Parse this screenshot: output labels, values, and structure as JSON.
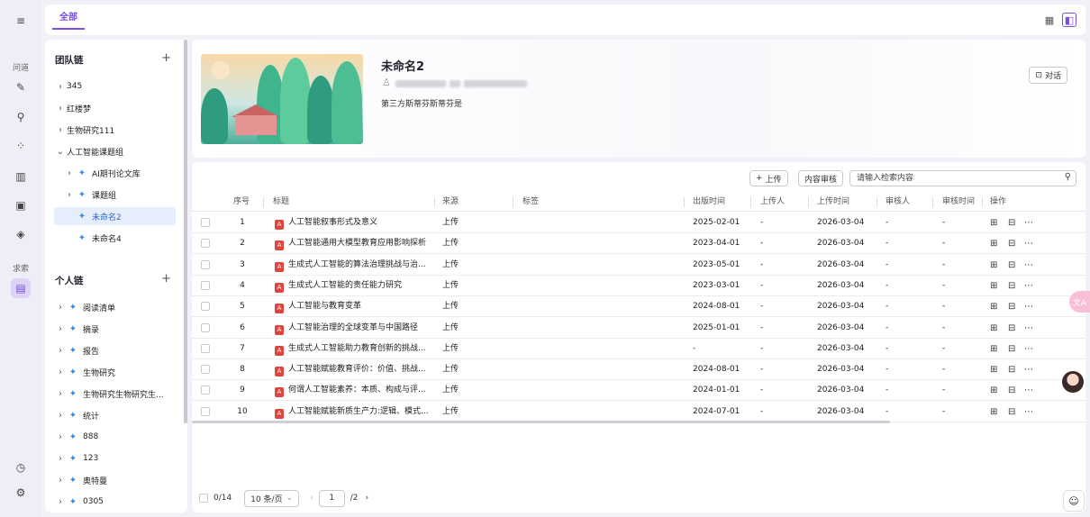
{
  "rail": {
    "section_ask": "问道",
    "section_search": "求索"
  },
  "topbar": {
    "tab_all": "全部"
  },
  "team_chain": {
    "title": "团队链",
    "items": [
      {
        "label": "345"
      },
      {
        "label": "红楼梦"
      },
      {
        "label": "生物研究111"
      },
      {
        "label": "人工智能课题组"
      },
      {
        "label": "AI期刊论文库"
      },
      {
        "label": "课题组"
      },
      {
        "label": "未命名2"
      },
      {
        "label": "未命名4"
      }
    ]
  },
  "personal_chain": {
    "title": "个人链",
    "items": [
      {
        "label": "阅读清单"
      },
      {
        "label": "摘录"
      },
      {
        "label": "报告"
      },
      {
        "label": "生物研究"
      },
      {
        "label": "生物研究生物研究生..."
      },
      {
        "label": "统计"
      },
      {
        "label": "888"
      },
      {
        "label": "123"
      },
      {
        "label": "奥特曼"
      },
      {
        "label": "0305"
      }
    ]
  },
  "card": {
    "title": "未命名2",
    "description": "第三方斯蒂芬斯蒂芬是",
    "dialog_button": "对话"
  },
  "toolbar": {
    "upload": "上传",
    "review": "内容审核",
    "search_placeholder": "请输入检索内容"
  },
  "table": {
    "columns": {
      "no": "序号",
      "title": "标题",
      "source": "来源",
      "tags": "标签",
      "published": "出版时间",
      "uploader": "上传人",
      "uploaded": "上传时间",
      "reviewer": "审核人",
      "reviewed": "审核时间",
      "actions": "操作"
    },
    "rows": [
      {
        "no": "1",
        "title": "人工智能叙事形式及意义",
        "source": "上传",
        "published": "2025-02-01",
        "uploader": "-",
        "uploaded": "2026-03-04",
        "reviewer": "-",
        "reviewed": "-"
      },
      {
        "no": "2",
        "title": "人工智能通用大模型教育应用影响探析",
        "source": "上传",
        "published": "2023-04-01",
        "uploader": "-",
        "uploaded": "2026-03-04",
        "reviewer": "-",
        "reviewed": "-"
      },
      {
        "no": "3",
        "title": "生成式人工智能的算法治理挑战与治...",
        "source": "上传",
        "published": "2023-05-01",
        "uploader": "-",
        "uploaded": "2026-03-04",
        "reviewer": "-",
        "reviewed": "-"
      },
      {
        "no": "4",
        "title": "生成式人工智能的责任能力研究",
        "source": "上传",
        "published": "2023-03-01",
        "uploader": "-",
        "uploaded": "2026-03-04",
        "reviewer": "-",
        "reviewed": "-"
      },
      {
        "no": "5",
        "title": "人工智能与教育变革",
        "source": "上传",
        "published": "2024-08-01",
        "uploader": "-",
        "uploaded": "2026-03-04",
        "reviewer": "-",
        "reviewed": "-"
      },
      {
        "no": "6",
        "title": "人工智能治理的全球变革与中国路径",
        "source": "上传",
        "published": "2025-01-01",
        "uploader": "-",
        "uploaded": "2026-03-04",
        "reviewer": "-",
        "reviewed": "-"
      },
      {
        "no": "7",
        "title": "生成式人工智能助力教育创新的挑战...",
        "source": "上传",
        "published": "-",
        "uploader": "-",
        "uploaded": "2026-03-04",
        "reviewer": "-",
        "reviewed": "-"
      },
      {
        "no": "8",
        "title": "人工智能赋能教育评价：价值、挑战...",
        "source": "上传",
        "published": "2024-08-01",
        "uploader": "-",
        "uploaded": "2026-03-04",
        "reviewer": "-",
        "reviewed": "-"
      },
      {
        "no": "9",
        "title": "何谓人工智能素养：本质、构成与评...",
        "source": "上传",
        "published": "2024-01-01",
        "uploader": "-",
        "uploaded": "2026-03-04",
        "reviewer": "-",
        "reviewed": "-"
      },
      {
        "no": "10",
        "title": "人工智能赋能新质生产力:逻辑、模式...",
        "source": "上传",
        "published": "2024-07-01",
        "uploader": "-",
        "uploaded": "2026-03-04",
        "reviewer": "-",
        "reviewed": "-"
      }
    ]
  },
  "pager": {
    "selected": "0/14",
    "page_size": "10 条/页",
    "current_page": "1",
    "total_pages": "/2"
  },
  "floating": {
    "translate": "文A"
  }
}
